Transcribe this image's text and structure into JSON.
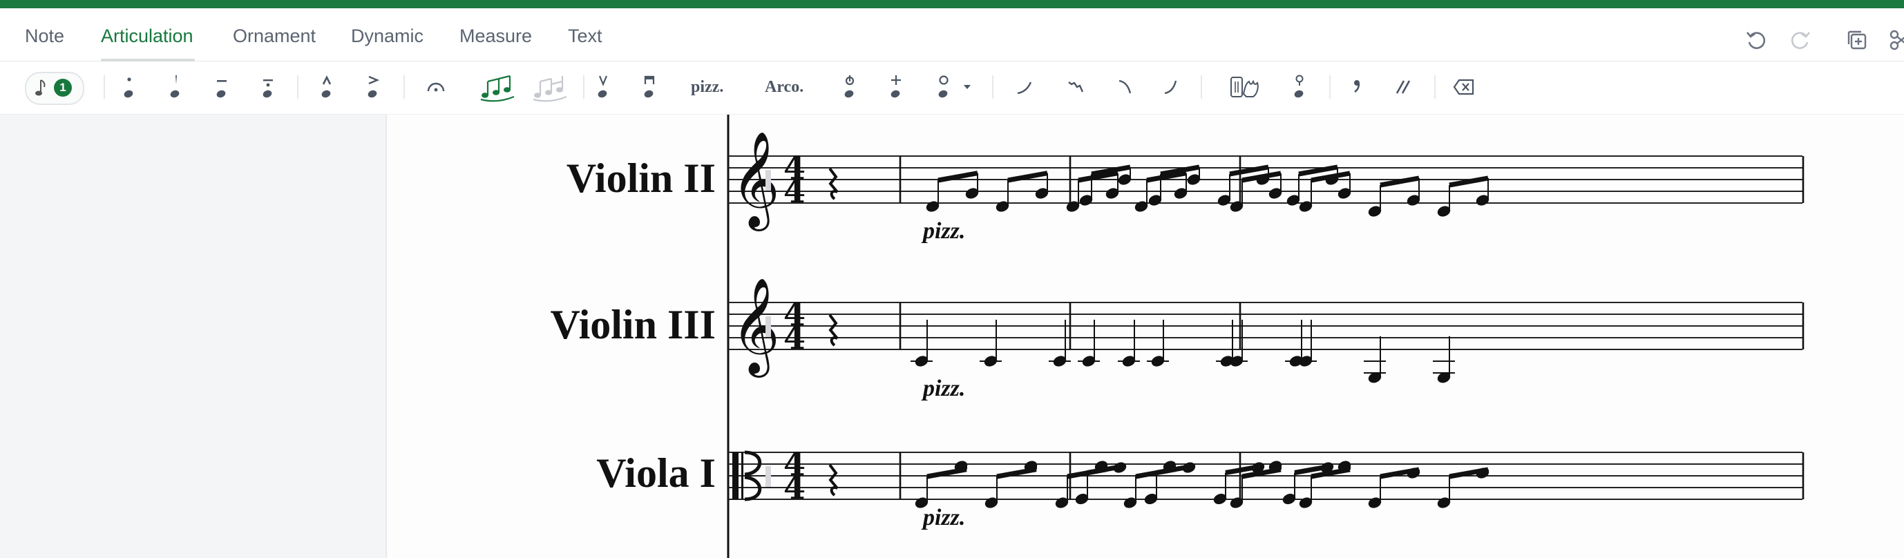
{
  "tabs": {
    "items": [
      {
        "label": "Note"
      },
      {
        "label": "Articulation"
      },
      {
        "label": "Ornament"
      },
      {
        "label": "Dynamic"
      },
      {
        "label": "Measure"
      },
      {
        "label": "Text"
      }
    ],
    "active": "Articulation"
  },
  "toolbar": {
    "voice_badge": "1",
    "pizz_label": "pizz.",
    "arco_label": "Arco."
  },
  "score": {
    "instruments": [
      {
        "name": "Violin II",
        "clef": "treble",
        "annotation": "pizz."
      },
      {
        "name": "Violin III",
        "clef": "treble",
        "annotation": "pizz."
      },
      {
        "name": "Viola I",
        "clef": "alto",
        "annotation": "pizz."
      }
    ],
    "time_signature": {
      "top": "4",
      "bottom": "4"
    }
  },
  "colors": {
    "accent": "#17783d",
    "top_bar": "#19793f",
    "icon": "#4b5563"
  }
}
